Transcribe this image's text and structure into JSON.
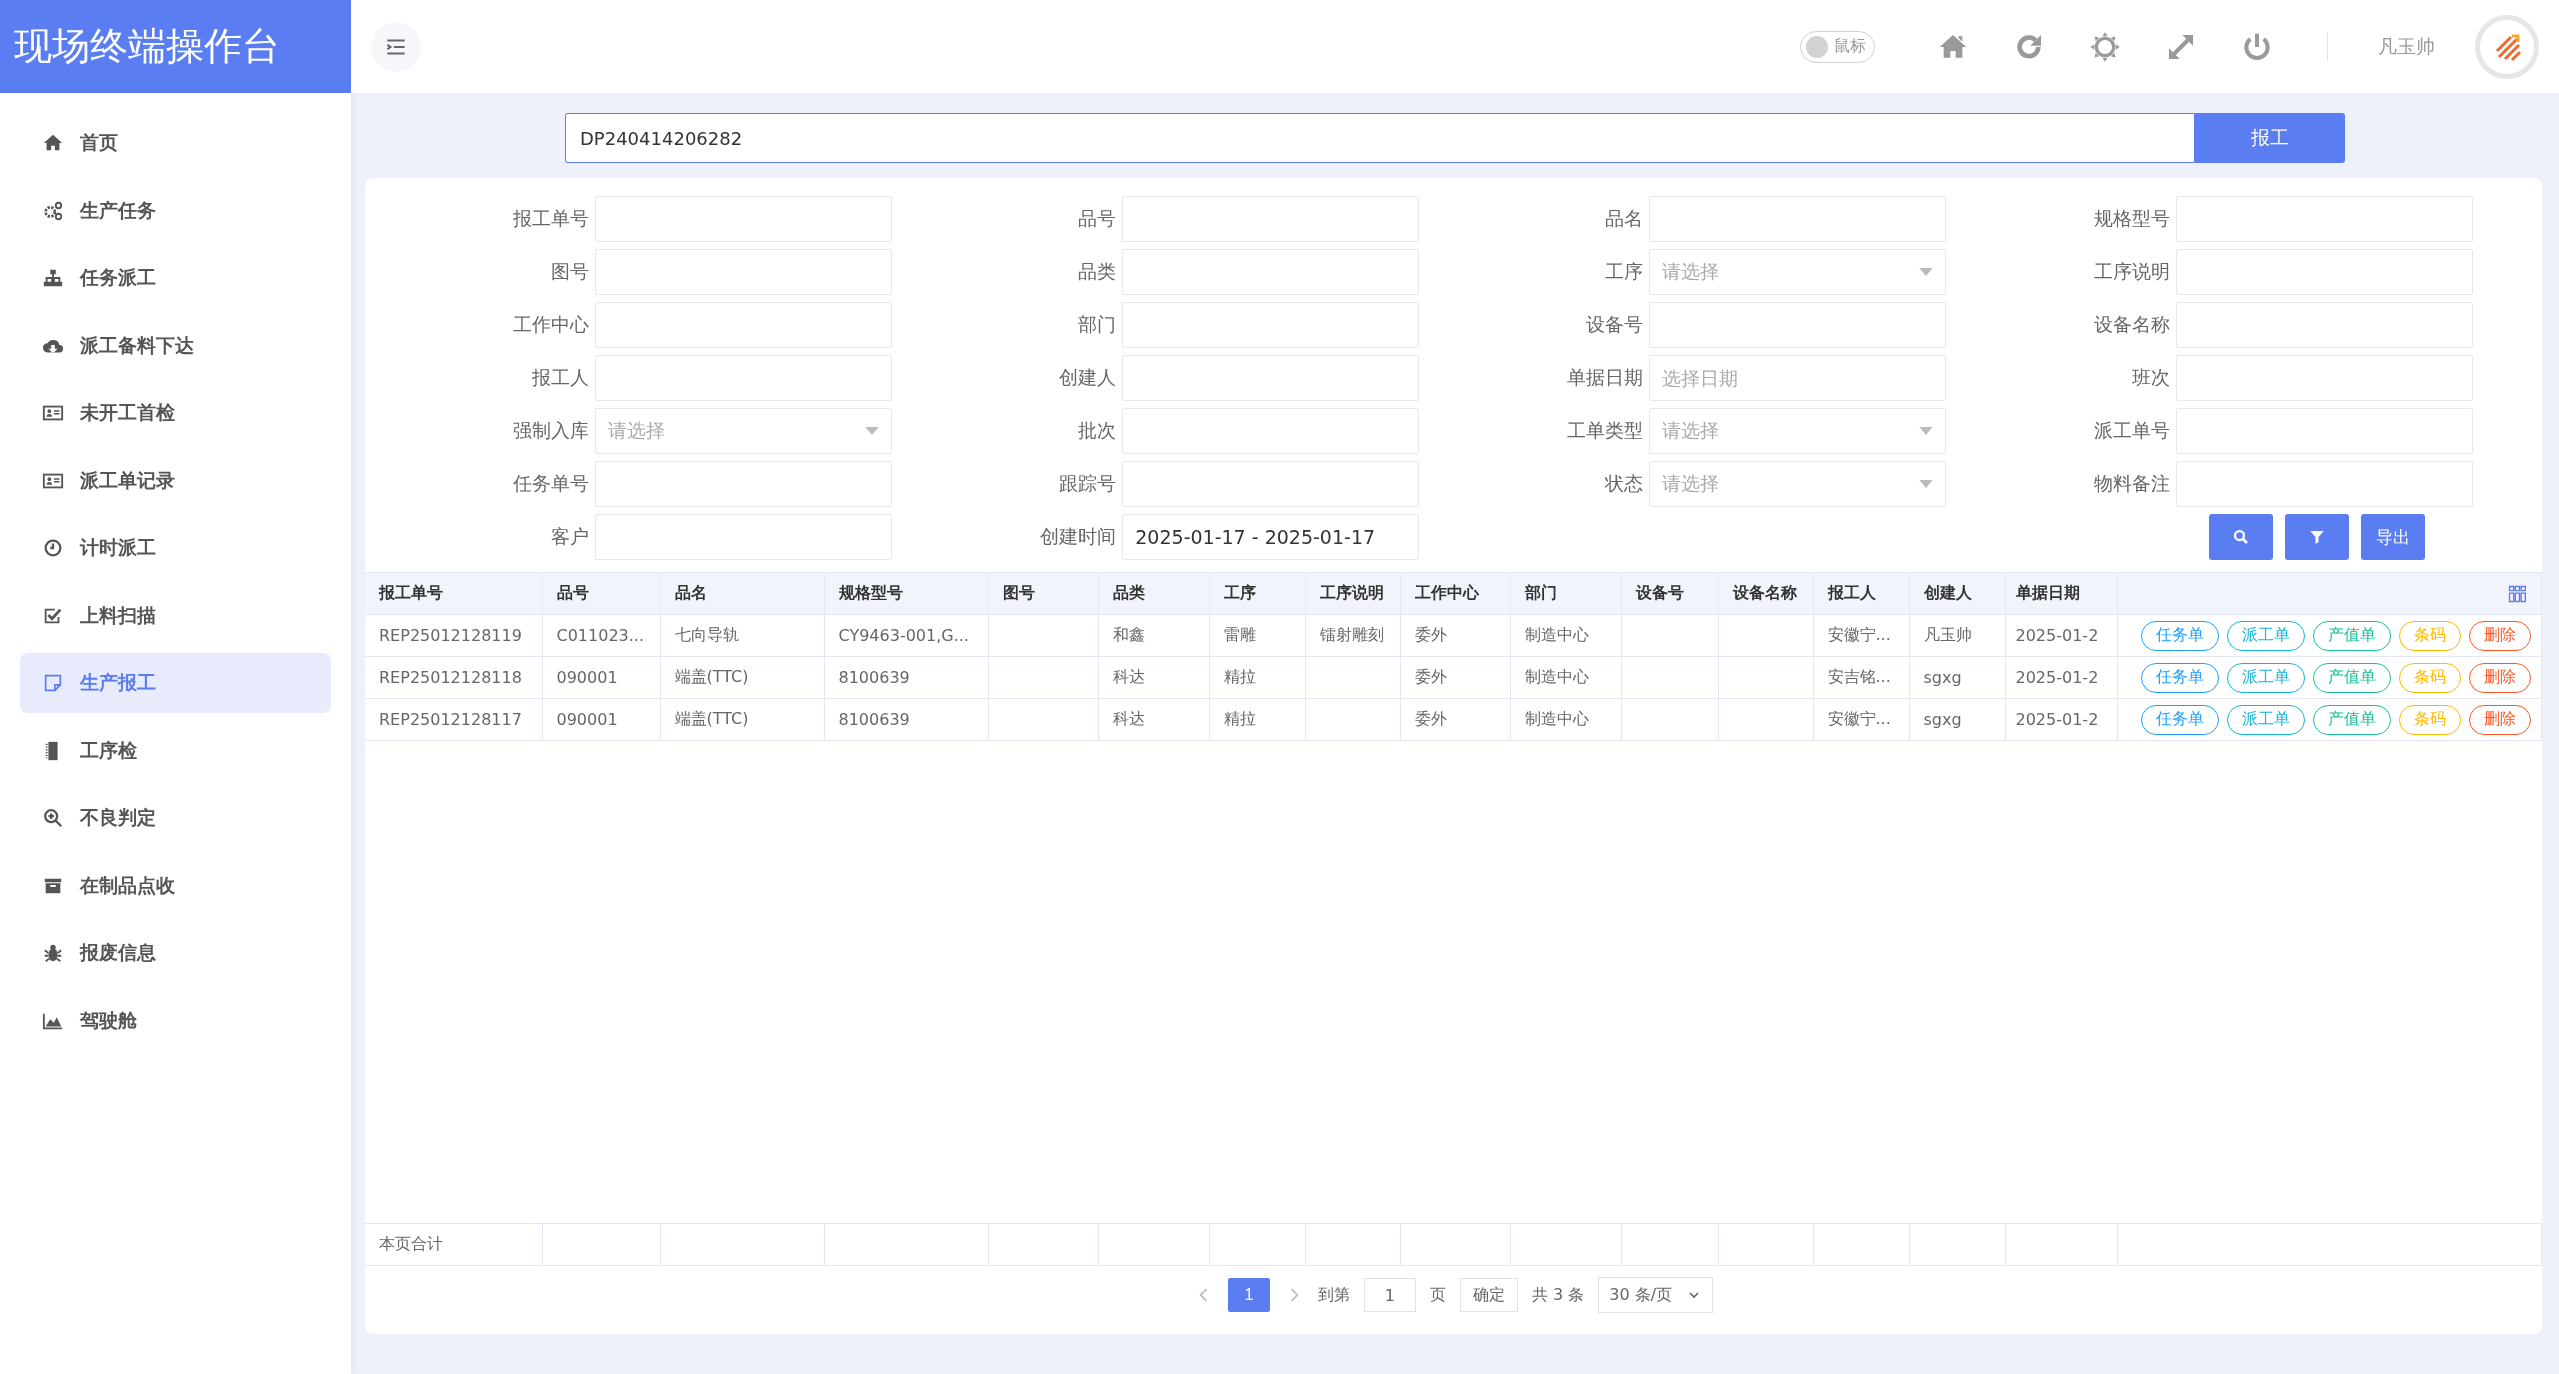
{
  "app_title": "现场终端操作台",
  "sidebar": {
    "items": [
      {
        "label": "首页",
        "selected": false
      },
      {
        "label": "生产任务",
        "selected": false
      },
      {
        "label": "任务派工",
        "selected": false
      },
      {
        "label": "派工备料下达",
        "selected": false
      },
      {
        "label": "未开工首检",
        "selected": false
      },
      {
        "label": "派工单记录",
        "selected": false
      },
      {
        "label": "计时派工",
        "selected": false
      },
      {
        "label": "上料扫描",
        "selected": false
      },
      {
        "label": "生产报工",
        "selected": true
      },
      {
        "label": "工序检",
        "selected": false
      },
      {
        "label": "不良判定",
        "selected": false
      },
      {
        "label": "在制品点收",
        "selected": false
      },
      {
        "label": "报废信息",
        "selected": false
      },
      {
        "label": "驾驶舱",
        "selected": false
      }
    ]
  },
  "topbar": {
    "toggle": {
      "label": "鼠标",
      "on": false
    },
    "user": "凡玉帅"
  },
  "scan": {
    "value": "DP240414206282",
    "button": "报工"
  },
  "filters": [
    {
      "label": "报工单号",
      "kind": "input"
    },
    {
      "label": "品号",
      "kind": "input"
    },
    {
      "label": "品名",
      "kind": "input"
    },
    {
      "label": "规格型号",
      "kind": "input"
    },
    {
      "label": "图号",
      "kind": "input"
    },
    {
      "label": "品类",
      "kind": "input"
    },
    {
      "label": "工序",
      "kind": "select",
      "placeholder": "请选择"
    },
    {
      "label": "工序说明",
      "kind": "input"
    },
    {
      "label": "工作中心",
      "kind": "input"
    },
    {
      "label": "部门",
      "kind": "input"
    },
    {
      "label": "设备号",
      "kind": "input"
    },
    {
      "label": "设备名称",
      "kind": "input"
    },
    {
      "label": "报工人",
      "kind": "input"
    },
    {
      "label": "创建人",
      "kind": "input"
    },
    {
      "label": "单据日期",
      "kind": "input",
      "placeholder": "选择日期"
    },
    {
      "label": "班次",
      "kind": "input"
    },
    {
      "label": "强制入库",
      "kind": "select",
      "placeholder": "请选择"
    },
    {
      "label": "批次",
      "kind": "input"
    },
    {
      "label": "工单类型",
      "kind": "select",
      "placeholder": "请选择"
    },
    {
      "label": "派工单号",
      "kind": "input"
    },
    {
      "label": "任务单号",
      "kind": "input"
    },
    {
      "label": "跟踪号",
      "kind": "input"
    },
    {
      "label": "状态",
      "kind": "select",
      "placeholder": "请选择"
    },
    {
      "label": "物料备注",
      "kind": "input"
    },
    {
      "label": "客户",
      "kind": "input"
    },
    {
      "label": "创建时间",
      "kind": "input",
      "value": "2025-01-17 - 2025-01-17"
    }
  ],
  "filter_actions": [
    {
      "kind": "search"
    },
    {
      "kind": "filter"
    },
    {
      "kind": "text",
      "label": "导出"
    }
  ],
  "table": {
    "columns": [
      "报工单号",
      "品号",
      "品名",
      "规格型号",
      "图号",
      "品类",
      "工序",
      "工序说明",
      "工作中心",
      "部门",
      "设备号",
      "设备名称",
      "报工人",
      "创建人",
      "单据日期"
    ],
    "rows": [
      {
        "cells": [
          "REP25012128119",
          "C011023...",
          "七向导轨",
          "CY9463-001,G...",
          "",
          "和鑫",
          "雷雕",
          "镭射雕刻",
          "委外",
          "制造中心",
          "",
          "",
          "安徽宁...",
          "凡玉帅",
          "2025-01-2"
        ],
        "actions": [
          {
            "label": "任务单",
            "color": "#1e9fff"
          },
          {
            "label": "派工单",
            "color": "#13b5d8"
          },
          {
            "label": "产值单",
            "color": "#19be9b"
          },
          {
            "label": "条码",
            "color": "#ffb800"
          },
          {
            "label": "删除",
            "color": "#ff5722"
          }
        ]
      },
      {
        "cells": [
          "REP25012128118",
          "090001",
          "端盖(TTC)",
          "8100639",
          "",
          "科达",
          "精拉",
          "",
          "委外",
          "制造中心",
          "",
          "",
          "安吉铭...",
          "sgxg",
          "2025-01-2"
        ],
        "actions": [
          {
            "label": "任务单",
            "color": "#1e9fff"
          },
          {
            "label": "派工单",
            "color": "#13b5d8"
          },
          {
            "label": "产值单",
            "color": "#19be9b"
          },
          {
            "label": "条码",
            "color": "#ffb800"
          },
          {
            "label": "删除",
            "color": "#ff5722"
          }
        ]
      },
      {
        "cells": [
          "REP25012128117",
          "090001",
          "端盖(TTC)",
          "8100639",
          "",
          "科达",
          "精拉",
          "",
          "委外",
          "制造中心",
          "",
          "",
          "安徽宁...",
          "sgxg",
          "2025-01-2"
        ],
        "actions": [
          {
            "label": "任务单",
            "color": "#1e9fff"
          },
          {
            "label": "派工单",
            "color": "#13b5d8"
          },
          {
            "label": "产值单",
            "color": "#19be9b"
          },
          {
            "label": "条码",
            "color": "#ffb800"
          },
          {
            "label": "删除",
            "color": "#ff5722"
          }
        ]
      }
    ],
    "summary_label": "本页合计"
  },
  "pagination": {
    "pages": [
      {
        "label": "1",
        "selected": true
      }
    ],
    "goto_label": "到第",
    "goto_value": "1",
    "page_unit": "页",
    "confirm": "确定",
    "total": "共 3 条",
    "page_size": "30 条/页"
  }
}
